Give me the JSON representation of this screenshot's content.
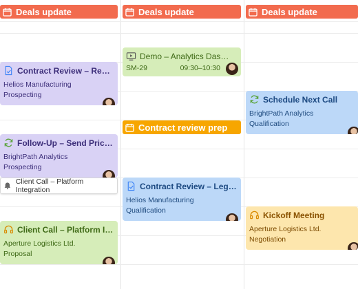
{
  "colors": {
    "deals_header": "#f26b4e",
    "allday_orange": "#f7a600",
    "purple_bg": "#d9d2f5",
    "green_bg": "#d6edb9",
    "blue_bg": "#bcd8f8",
    "yellow_bg": "#fde6ad"
  },
  "all_day": [
    {
      "label": "Deals update",
      "icon": "calendar-icon"
    },
    {
      "label": "Deals update",
      "icon": "calendar-icon"
    },
    {
      "label": "Deals update",
      "icon": "calendar-icon"
    }
  ],
  "events": {
    "contract_review_ren": {
      "title": "Contract Review – Ren…",
      "company": "Helios Manufacturing",
      "stage": "Prospecting",
      "icon": "document-check-icon"
    },
    "demo_analytics": {
      "title": "Demo – Analytics Das…",
      "code": "SM-29",
      "time": "09:30–10:30",
      "icon": "video-icon"
    },
    "schedule_next_call": {
      "title": "Schedule Next Call",
      "company": "BrightPath Analytics",
      "stage": "Qualification",
      "icon": "refresh-icon"
    },
    "contract_review_prep": {
      "title": "Contract review prep",
      "icon": "calendar-icon"
    },
    "follow_up": {
      "title": "Follow-Up – Send Prici…",
      "company": "BrightPath Analytics",
      "stage": "Prospecting",
      "icon": "refresh-icon"
    },
    "client_call_reminder": {
      "title": "Client Call – Platform Integration",
      "icon": "bell-icon"
    },
    "contract_review_leg": {
      "title": "Contract Review – Leg…",
      "company": "Helios Manufacturing",
      "stage": "Qualification",
      "icon": "document-check-icon"
    },
    "client_call_platform": {
      "title": "Client Call – Platform I…",
      "company": "Aperture Logistics Ltd.",
      "stage": "Proposal",
      "icon": "headset-icon"
    },
    "kickoff_meeting": {
      "title": "Kickoff Meeting",
      "company": "Aperture Logistics Ltd.",
      "stage": "Negotiation",
      "icon": "headset-icon"
    }
  }
}
